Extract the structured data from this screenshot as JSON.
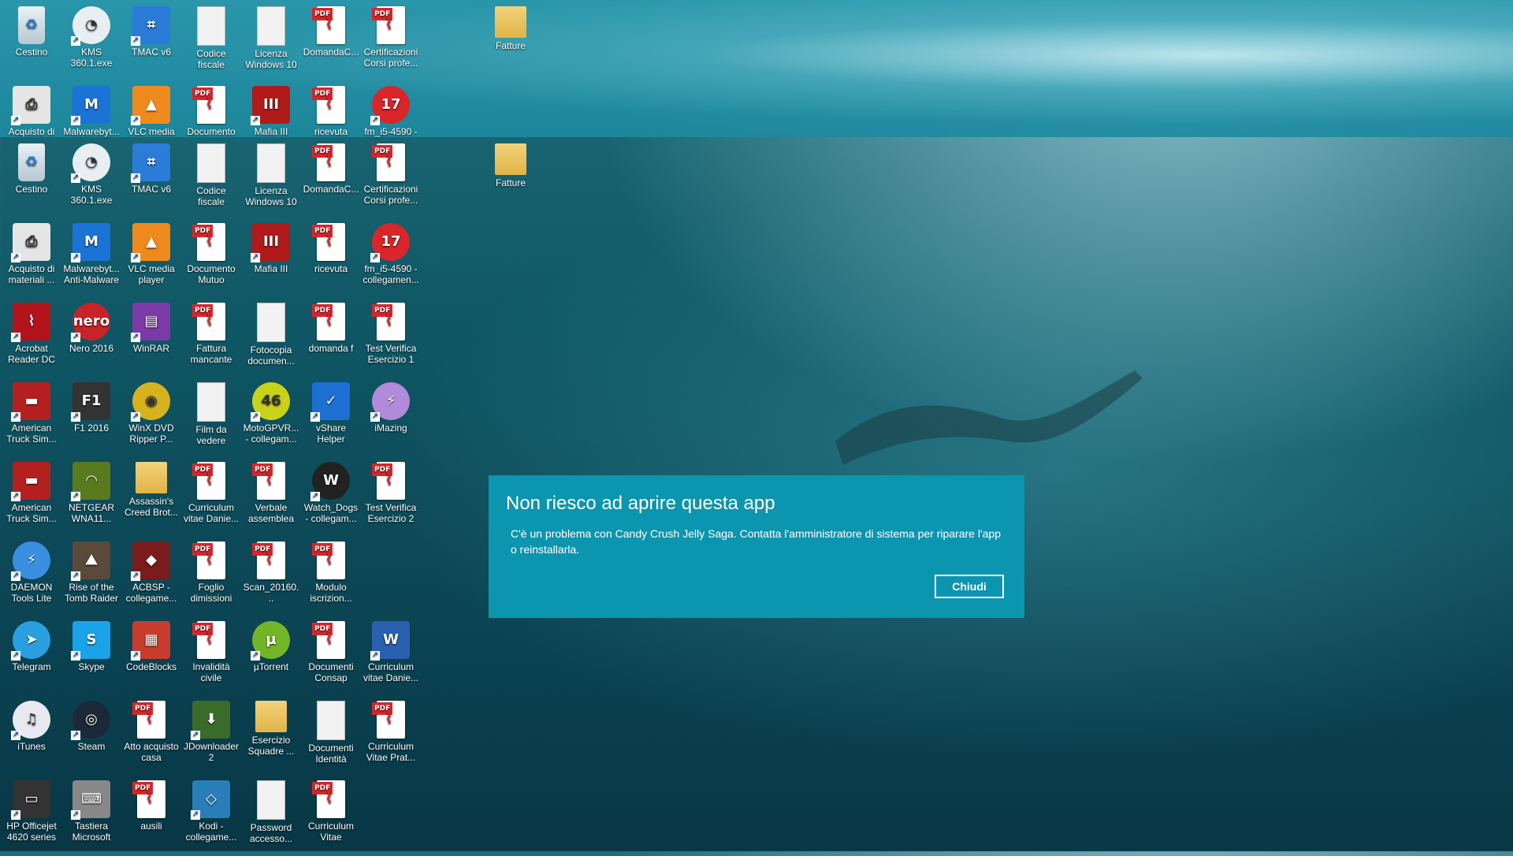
{
  "dialog": {
    "title": "Non riesco ad aprire questa app",
    "message": "C'è un problema con Candy Crush Jelly Saga. Contatta l'amministratore di sistema per riparare l'app o reinstallarla.",
    "button": "Chiudi"
  },
  "icons": {
    "r1": [
      "Cestino",
      "KMS 360.1.exe",
      "TMAC v6",
      "Codice fiscale",
      "Licenza Windows 10",
      "DomandaC...",
      "Certificazioni Corsi profe..."
    ],
    "r1_extra": "Fatture",
    "r2": [
      "Acquisto di",
      "Malwarebyt...",
      "VLC media",
      "Documento",
      "Mafia III",
      "ricevuta",
      "fm_i5-4590  -"
    ],
    "r3": [
      "Cestino",
      "KMS 360.1.exe",
      "TMAC v6",
      "Codice fiscale",
      "Licenza Windows 10",
      "DomandaC...",
      "Certificazioni Corsi profe..."
    ],
    "r3_extra": "Fatture",
    "r4": [
      "Acquisto di materiali ...",
      "Malwarebyt... Anti-Malware",
      "VLC media player",
      "Documento Mutuo",
      "Mafia III",
      "ricevuta",
      "fm_i5-4590  - collegamen..."
    ],
    "r5": [
      "Acrobat Reader DC",
      "Nero 2016",
      "WinRAR",
      "Fattura mancante",
      "Fotocopia documen...",
      "domanda f",
      "Test Verifica Esercizio 1"
    ],
    "r6": [
      "American Truck Sim...",
      "F1 2016",
      "WinX DVD Ripper P...",
      "Film da vedere",
      "MotoGPVR... - collegam...",
      "vShare Helper",
      "iMazing"
    ],
    "r7": [
      "American Truck Sim...",
      "NETGEAR WNA11...",
      "Assassin's Creed Brot...",
      "Curriculum vitae Danie...",
      "Verbale assemblea",
      "Watch_Dogs - collegam...",
      "Test Verifica Esercizio 2"
    ],
    "r8": [
      "DAEMON Tools Lite",
      "Rise of the Tomb Raider",
      "ACBSP - collegame...",
      "Foglio dimissioni",
      "Scan_20160...",
      "Modulo iscrizion..."
    ],
    "r9": [
      "Telegram",
      "Skype",
      "CodeBlocks",
      "Invalidità civile",
      "µTorrent",
      "Documenti Consap",
      "Curriculum vitae Danie..."
    ],
    "r10": [
      "iTunes",
      "Steam",
      "Atto acquisto casa",
      "JDownloader 2",
      "Esercizio Squadre ...",
      "Documenti Identità",
      "Curriculum Vitae Prat..."
    ],
    "r11": [
      "HP Officejet 4620 series",
      "Tastiera Microsoft",
      "ausili",
      "Kodi - collegame...",
      "Password accesso...",
      "Curriculum Vitae"
    ]
  },
  "glyphs": {
    "bin": "♻",
    "kms": "◔",
    "tmac": "⌗",
    "vlc": "▲",
    "malware": "M",
    "mafia": "III",
    "seventeen": "17",
    "acrobat": "⌇",
    "nero": "nero",
    "winrar": "▤",
    "f1": "F1",
    "winx": "◉",
    "moto": "46",
    "vshare": "✓",
    "imazing": "⚡",
    "truck": "▬",
    "netgear": "◠",
    "assassin": "◆",
    "watch": "W",
    "daemon": "⚡",
    "tomb": "⛰",
    "telegram": "➤",
    "skype": "S",
    "codeblocks": "▦",
    "utorrent": "µ",
    "word": "W",
    "itunes": "♫",
    "steam": "◎",
    "jd": "⬇",
    "hp": "▭",
    "keyboard": "⌨",
    "kodi": "◇",
    "printer": "⎙"
  },
  "colors": {
    "dialog_bg": "#0b95ae",
    "pdf_red": "#d8262b"
  }
}
